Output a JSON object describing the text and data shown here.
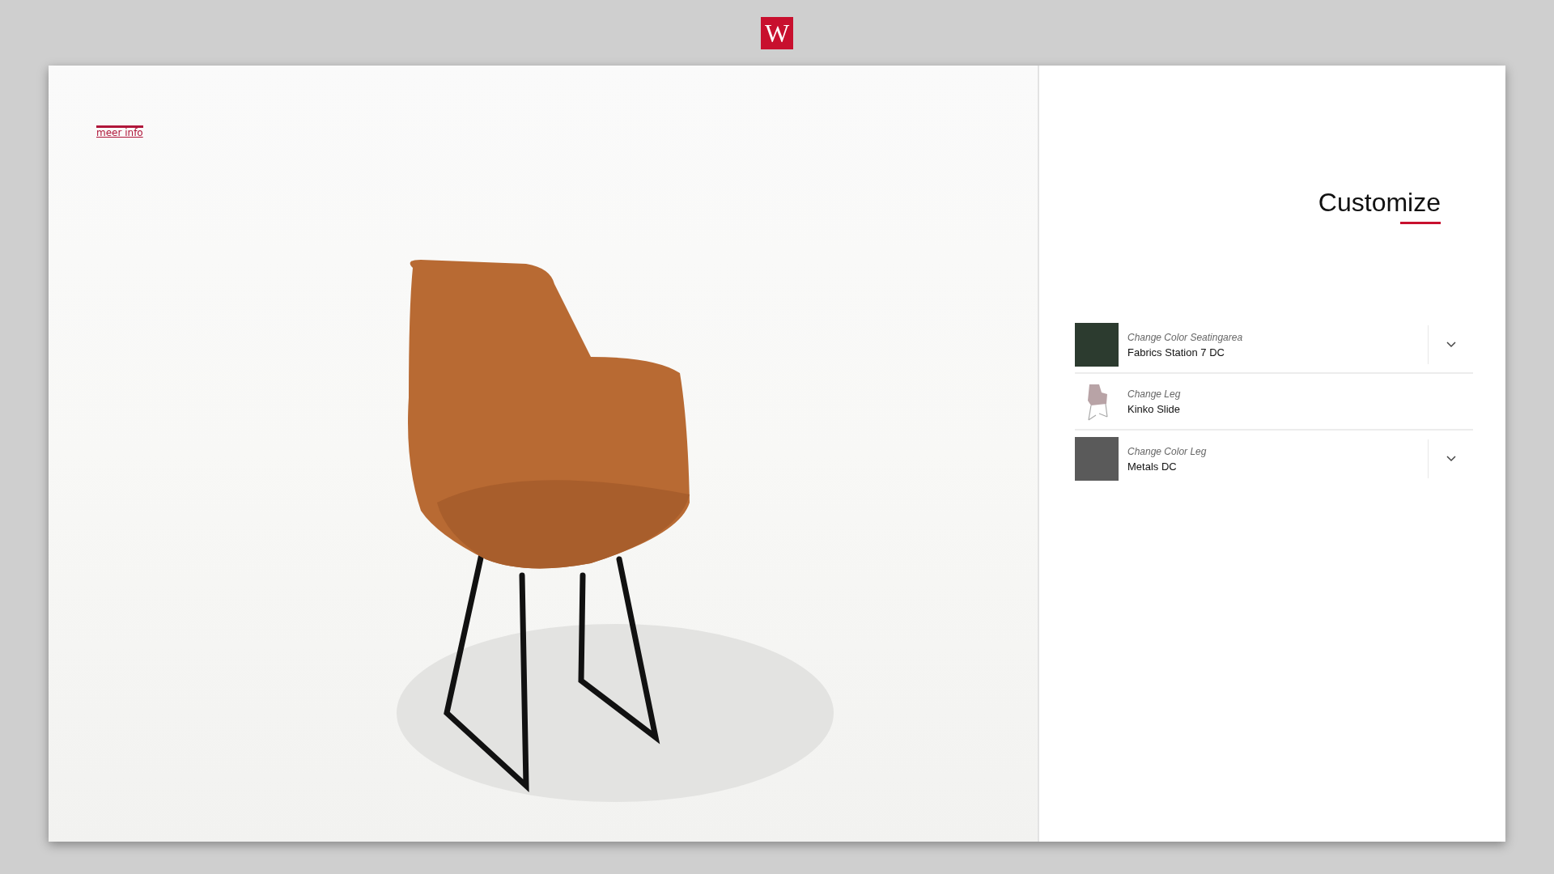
{
  "logo": {
    "text": "W"
  },
  "viewer": {
    "info_link": "meer info"
  },
  "panel": {
    "title": "Customize",
    "options": [
      {
        "kind": "swatch",
        "color": "#2c3b2f",
        "label": "Change Color Seatingarea",
        "value": "Fabrics Station 7 DC",
        "expandable": true
      },
      {
        "kind": "chair",
        "label": "Change Leg",
        "value": "Kinko Slide",
        "expandable": false
      },
      {
        "kind": "swatch",
        "color": "#5a5a5a",
        "label": "Change Color Leg",
        "value": "Metals DC",
        "expandable": true
      }
    ]
  }
}
